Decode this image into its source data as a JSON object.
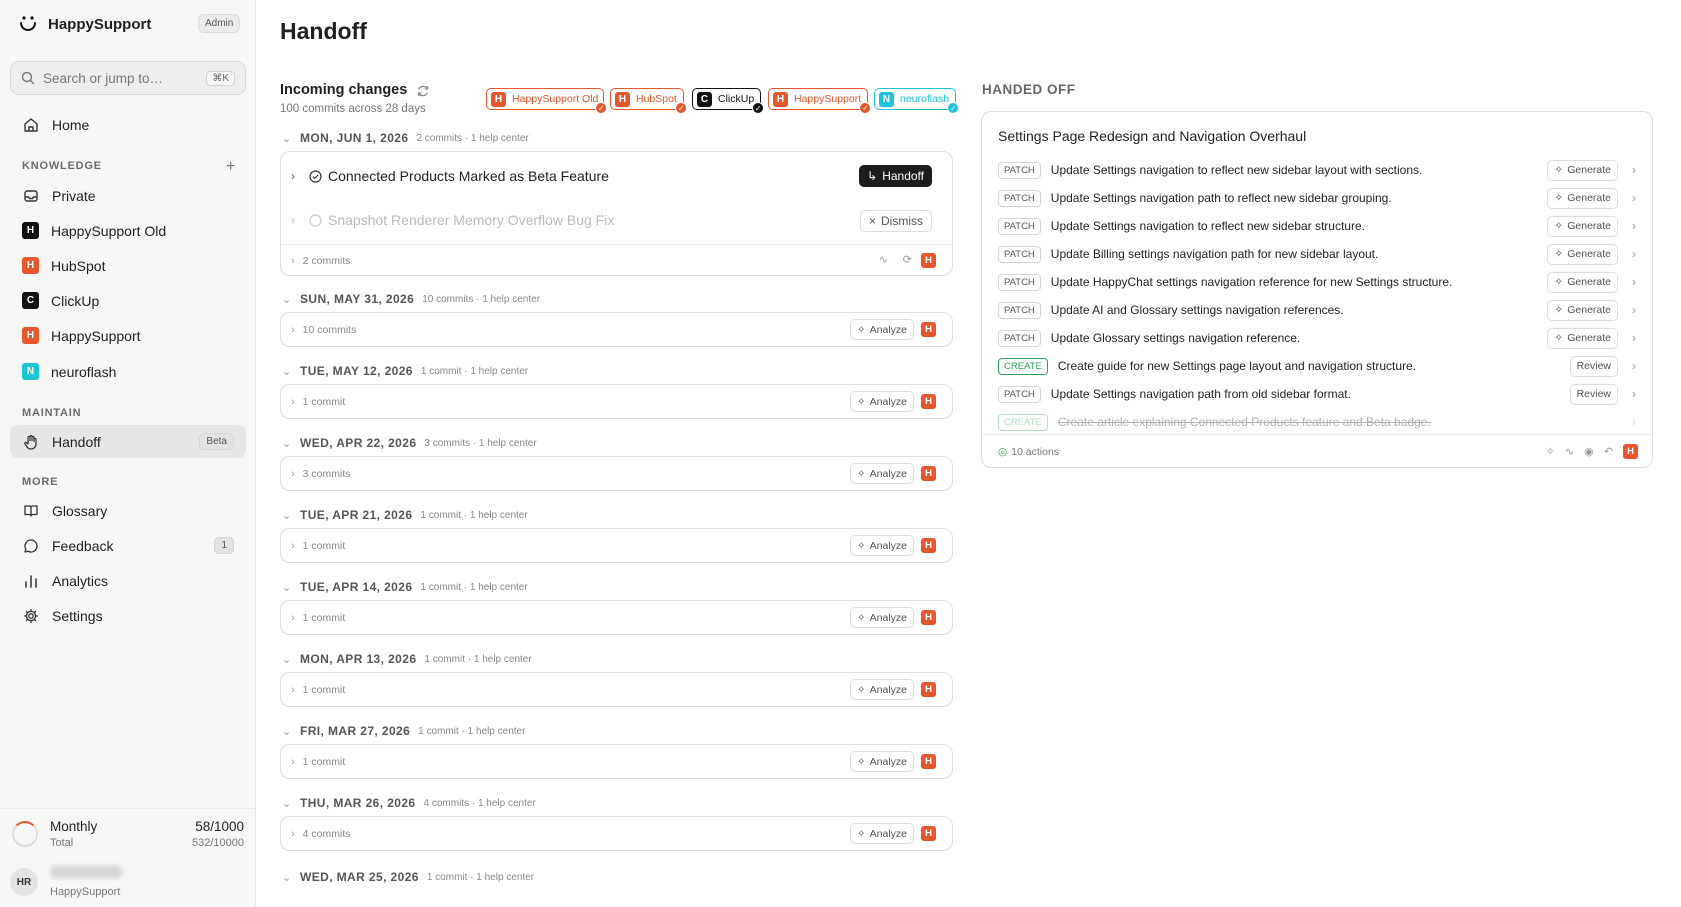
{
  "sidebar": {
    "brand": "HappySupport",
    "admin_badge": "Admin",
    "search_placeholder": "Search or jump to…",
    "search_shortcut": "⌘K",
    "home": "Home",
    "knowledge_label": "KNOWLEDGE",
    "knowledge_items": [
      {
        "label": "Private",
        "icon": "inbox-icon"
      },
      {
        "label": "HappySupport Old",
        "letter": "H",
        "color": "#111111"
      },
      {
        "label": "HubSpot",
        "letter": "H",
        "color": "#e5572c"
      },
      {
        "label": "ClickUp",
        "letter": "C",
        "color": "#111111"
      },
      {
        "label": "HappySupport",
        "letter": "H",
        "color": "#e5572c"
      },
      {
        "label": "neuroflash",
        "letter": "N",
        "color": "#1fc3d6"
      }
    ],
    "maintain_label": "MAINTAIN",
    "handoff": "Handoff",
    "handoff_badge": "Beta",
    "more_label": "MORE",
    "glossary": "Glossary",
    "feedback": "Feedback",
    "feedback_count": "1",
    "analytics": "Analytics",
    "settings": "Settings",
    "usage": {
      "title": "Monthly",
      "sub": "Total",
      "value": "58/1000",
      "total": "532/10000"
    },
    "user": {
      "initials": "HR",
      "org": "HappySupport"
    }
  },
  "main": {
    "title": "Handoff",
    "incoming_title": "Incoming changes",
    "incoming_sub": "100 commits across 28 days",
    "sources": [
      {
        "label": "HappySupport Old",
        "letter": "H",
        "color": "#e5572c",
        "check_color": "#e5572c"
      },
      {
        "label": "HubSpot",
        "letter": "H",
        "color": "#e5572c",
        "check_color": "#e5572c"
      },
      {
        "label": "ClickUp",
        "letter": "C",
        "color": "#111111",
        "check_color": "#111111"
      },
      {
        "label": "HappySupport",
        "letter": "H",
        "color": "#e5572c",
        "check_color": "#e5572c"
      },
      {
        "label": "neuroflash",
        "letter": "N",
        "color": "#1fc3d6",
        "check_color": "#1fc3d6"
      }
    ],
    "first_day": {
      "date": "MON, JUN 1, 2026",
      "meta": "2 commits · 1 help center",
      "item1": "Connected Products Marked as Beta Feature",
      "handoff_btn": "Handoff",
      "item2": "Snapshot Renderer Memory Overflow Bug Fix",
      "dismiss_btn": "Dismiss",
      "commits": "2 commits",
      "h_badge": "H"
    },
    "analyze_label": "Analyze",
    "days": [
      {
        "date": "SUN, MAY 31, 2026",
        "meta": "10 commits · 1 help center",
        "commits": "10 commits"
      },
      {
        "date": "TUE, MAY 12, 2026",
        "meta": "1 commit · 1 help center",
        "commits": "1 commit"
      },
      {
        "date": "WED, APR 22, 2026",
        "meta": "3 commits · 1 help center",
        "commits": "3 commits"
      },
      {
        "date": "TUE, APR 21, 2026",
        "meta": "1 commit · 1 help center",
        "commits": "1 commit"
      },
      {
        "date": "TUE, APR 14, 2026",
        "meta": "1 commit · 1 help center",
        "commits": "1 commit"
      },
      {
        "date": "MON, APR 13, 2026",
        "meta": "1 commit · 1 help center",
        "commits": "1 commit"
      },
      {
        "date": "FRI, MAR 27, 2026",
        "meta": "1 commit · 1 help center",
        "commits": "1 commit"
      },
      {
        "date": "THU, MAR 26, 2026",
        "meta": "4 commits · 1 help center",
        "commits": "4 commits"
      }
    ],
    "last_day": {
      "date": "WED, MAR 25, 2026",
      "meta": "1 commit · 1 help center"
    }
  },
  "handed_off": {
    "title": "HANDED OFF",
    "card_title": "Settings Page Redesign and Navigation Overhaul",
    "actions": [
      {
        "tag": "PATCH",
        "text": "Update Settings navigation to reflect new sidebar layout with sections.",
        "button": "Generate"
      },
      {
        "tag": "PATCH",
        "text": "Update Settings navigation path to reflect new sidebar grouping.",
        "button": "Generate"
      },
      {
        "tag": "PATCH",
        "text": "Update Settings navigation to reflect new sidebar structure.",
        "button": "Generate"
      },
      {
        "tag": "PATCH",
        "text": "Update Billing settings navigation path for new sidebar layout.",
        "button": "Generate"
      },
      {
        "tag": "PATCH",
        "text": "Update HappyChat settings navigation reference for new Settings structure.",
        "button": "Generate"
      },
      {
        "tag": "PATCH",
        "text": "Update AI and Glossary settings navigation references.",
        "button": "Generate"
      },
      {
        "tag": "PATCH",
        "text": "Update Glossary settings navigation reference.",
        "button": "Generate"
      },
      {
        "tag": "CREATE",
        "text": "Create guide for new Settings page layout and navigation structure.",
        "button": "Review"
      },
      {
        "tag": "PATCH",
        "text": "Update Settings navigation path from old sidebar format.",
        "button": "Review"
      },
      {
        "tag": "CREATE",
        "text": "Create article explaining Connected Products feature and Beta badge.",
        "button": ""
      }
    ],
    "actions_count": "10 actions",
    "h_badge": "H"
  }
}
